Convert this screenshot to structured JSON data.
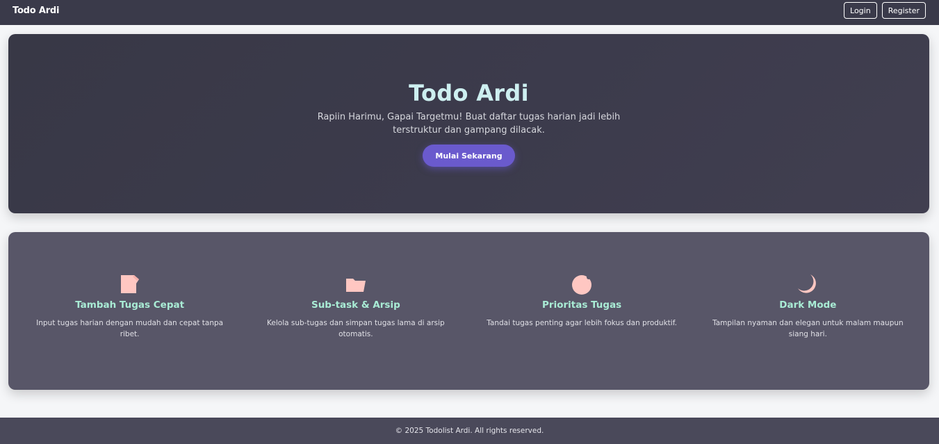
{
  "navbar": {
    "brand": "Todo Ardi",
    "login_label": "Login",
    "register_label": "Register"
  },
  "hero": {
    "title": "Todo Ardi",
    "subtitle": "Rapiin Harimu, Gapai Targetmu! Buat daftar tugas harian jadi lebih terstruktur dan gampang dilacak.",
    "cta_label": "Mulai Sekarang"
  },
  "features": [
    {
      "icon": "memo-icon",
      "title": "Tambah Tugas Cepat",
      "desc": "Input tugas harian dengan mudah dan cepat tanpa ribet."
    },
    {
      "icon": "folder-icon",
      "title": "Sub-task & Arsip",
      "desc": "Kelola sub-tugas dan simpan tugas lama di arsip otomatis."
    },
    {
      "icon": "target-icon",
      "title": "Prioritas Tugas",
      "desc": "Tandai tugas penting agar lebih fokus dan produktif."
    },
    {
      "icon": "moon-icon",
      "title": "Dark Mode",
      "desc": "Tampilan nyaman dan elegan untuk malam maupun siang hari."
    }
  ],
  "footer": {
    "text": "© 2025 Todolist Ardi. All rights reserved."
  },
  "colors": {
    "navbar_bg": "#3a3a4a",
    "accent": "#6a5acd",
    "hero_title": "#cdeff0",
    "feature_title": "#a9ecd5",
    "icon_fill": "#ffc7c2"
  }
}
